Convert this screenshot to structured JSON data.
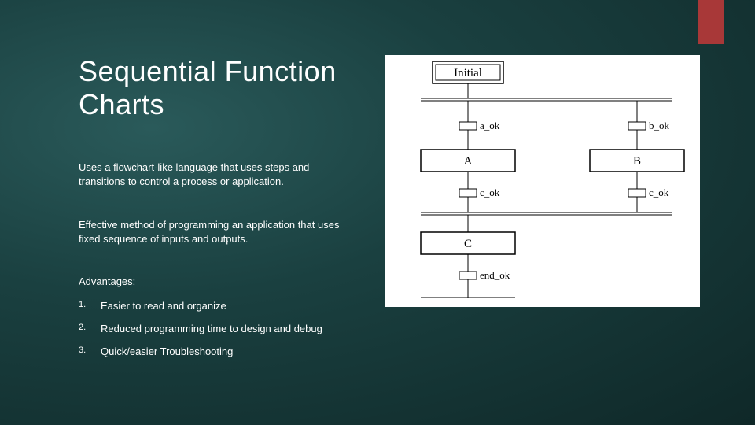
{
  "accent_color": "#a83838",
  "title": "Sequential Function Charts",
  "paragraphs": [
    "Uses a flowchart-like language that uses steps and transitions to control a process or application.",
    "Effective method of programming an application that uses fixed sequence of inputs and outputs."
  ],
  "advantages_label": "Advantages:",
  "advantages": [
    "Easier to read and organize",
    "Reduced programming time to design and debug",
    "Quick/easier Troubleshooting"
  ],
  "diagram": {
    "steps": {
      "initial": "Initial",
      "a": "A",
      "b": "B",
      "c": "C"
    },
    "transitions": {
      "a_ok": "a_ok",
      "b_ok": "b_ok",
      "c_ok_left": "c_ok",
      "c_ok_right": "c_ok",
      "end_ok": "end_ok"
    }
  }
}
